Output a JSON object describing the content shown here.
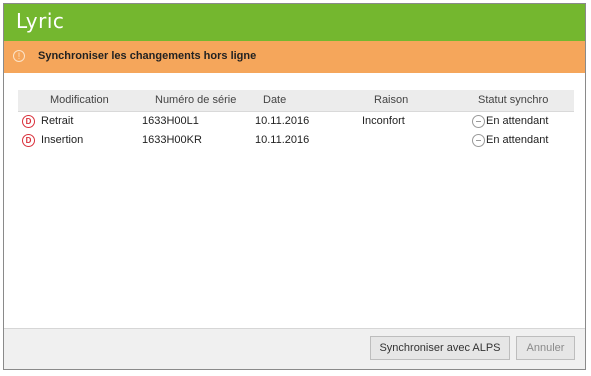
{
  "app": {
    "logo_text": "Lyric"
  },
  "banner": {
    "icon": "info-circle-icon",
    "text": "Synchroniser les changements hors ligne"
  },
  "table": {
    "headers": {
      "modification": "Modification",
      "serial": "Numéro de série",
      "date": "Date",
      "reason": "Raison",
      "status": "Statut synchro"
    },
    "rows": [
      {
        "icon": "d-circle-icon",
        "modification": "Retrait",
        "serial": "1633H00L1",
        "date": "10.11.2016",
        "reason": "Inconfort",
        "status_icon": "pending-icon",
        "status": "En attendant"
      },
      {
        "icon": "d-circle-icon",
        "modification": "Insertion",
        "serial": "1633H00KR",
        "date": "10.11.2016",
        "reason": "",
        "status_icon": "pending-icon",
        "status": "En attendant"
      }
    ]
  },
  "footer": {
    "sync_button": "Synchroniser avec ALPS",
    "cancel_button": "Annuler"
  },
  "colors": {
    "titlebar": "#74b72f",
    "banner": "#f5a65b",
    "device_icon": "#d9313c"
  }
}
